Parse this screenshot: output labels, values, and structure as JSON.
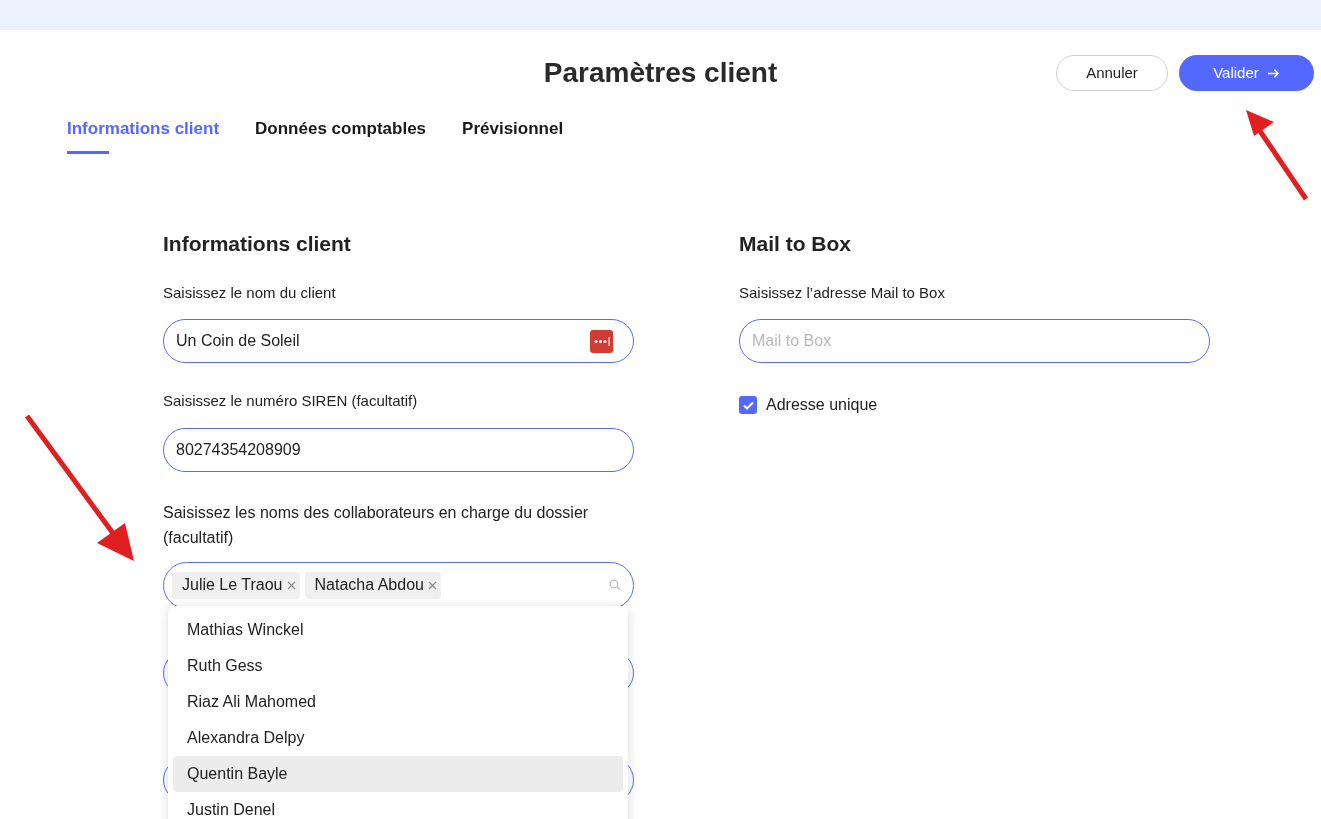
{
  "header": {
    "title": "Paramètres client",
    "buttons": [
      {
        "label": "Annuler",
        "kind": "secondary"
      },
      {
        "label": "Valider",
        "kind": "primary"
      }
    ]
  },
  "tabs": [
    {
      "label": "Informations client",
      "selected": true
    },
    {
      "label": "Données comptables",
      "selected": false
    },
    {
      "label": "Prévisionnel",
      "selected": false
    }
  ],
  "client_section": {
    "title": "Informations client",
    "name_field": {
      "label": "Saisissez le nom du client",
      "value": "Un Coin de Soleil"
    },
    "siren_field": {
      "label": "Saisissez le numéro SIREN (facultatif)",
      "value": "80274354208909"
    },
    "collaborators_field": {
      "label": "Saisissez les noms des collaborateurs en charge du dossier (facultatif)",
      "tags": [
        "Julie Le Traou",
        "Natacha Abdou"
      ]
    },
    "dropdown": [
      {
        "label": "Mathias Winckel",
        "selected": false
      },
      {
        "label": "Ruth Gess",
        "selected": false
      },
      {
        "label": "Riaz Ali Mahomed",
        "selected": false
      },
      {
        "label": "Alexandra Delpy",
        "selected": false
      },
      {
        "label": "Quentin Bayle",
        "selected": true
      },
      {
        "label": "Justin Denel",
        "selected": false
      }
    ]
  },
  "mail_section": {
    "title": "Mail to Box",
    "field": {
      "label": "Saisissez l’adresse Mail to Box",
      "placeholder": "Mail to Box"
    },
    "checkbox": {
      "label": "Adresse unique",
      "checked": true
    }
  }
}
